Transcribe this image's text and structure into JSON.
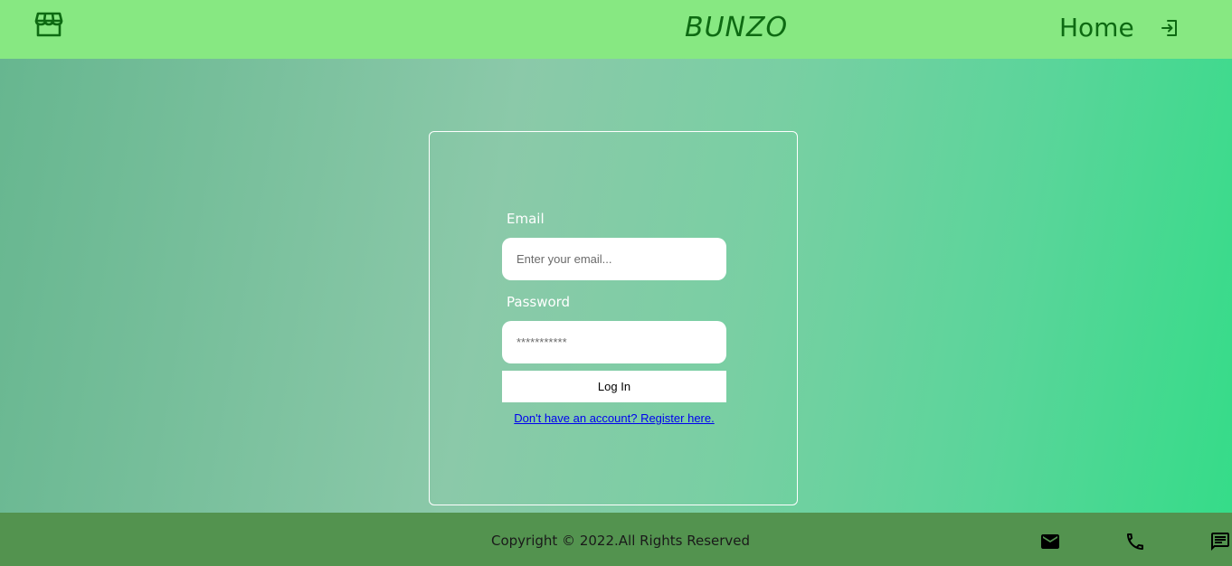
{
  "header": {
    "brand": "BUNZO",
    "home_label": "Home",
    "icons": {
      "store": "store-icon",
      "login": "login-icon"
    },
    "colors": {
      "background": "#87e882",
      "text": "#0d6a12"
    }
  },
  "login_form": {
    "email_label": "Email",
    "email_placeholder": "Enter your email...",
    "email_value": "",
    "password_label": "Password",
    "password_placeholder": "***********",
    "password_value": "",
    "submit_label": "Log In",
    "register_link": "Don't have an account? Register here."
  },
  "footer": {
    "copyright": "Copyright © 2022.All Rights Reserved",
    "icons": [
      "mail-icon",
      "phone-icon",
      "chat-icon"
    ],
    "colors": {
      "background": "#53934f"
    }
  }
}
